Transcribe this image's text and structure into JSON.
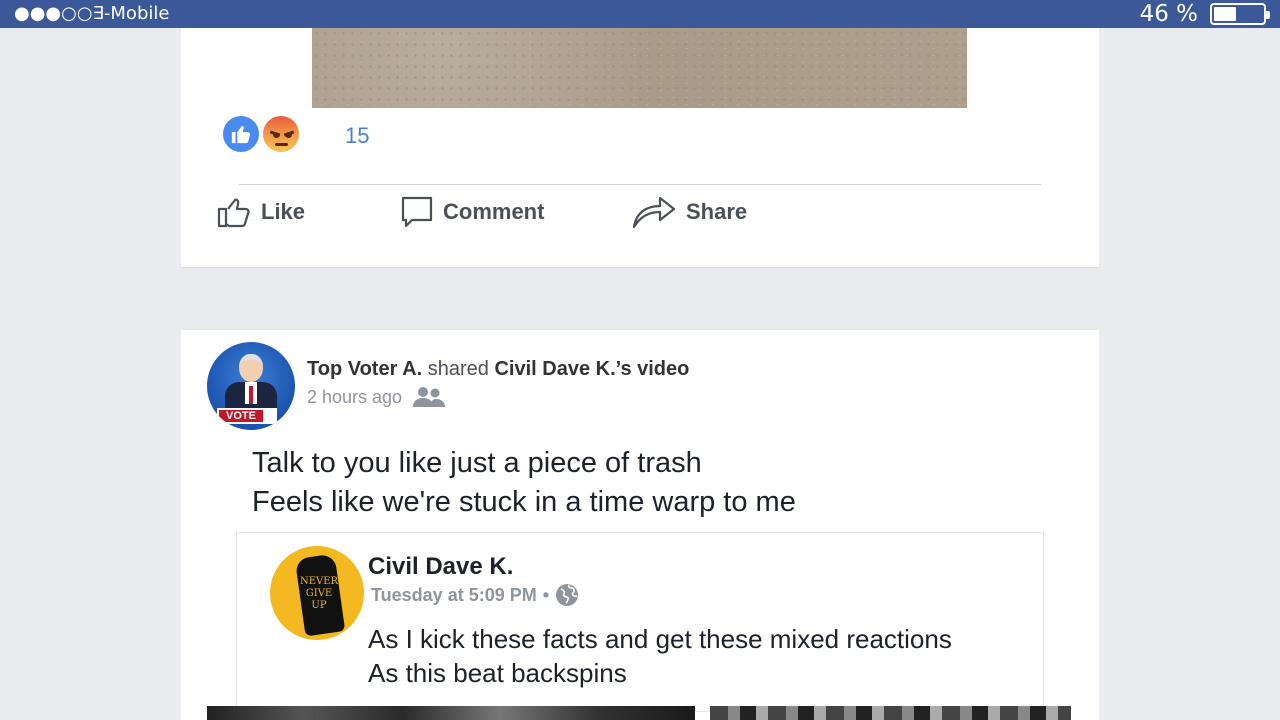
{
  "status_bar": {
    "carrier": "●●●○○∃-Mobile",
    "battery_percent": "46 %",
    "battery_level": 0.46
  },
  "post1": {
    "reaction_count": "15",
    "reactions": [
      "like-icon",
      "angry-icon"
    ],
    "actions": {
      "like": "Like",
      "comment": "Comment",
      "share": "Share"
    }
  },
  "post2": {
    "author": "Top Voter A.",
    "verb": "shared",
    "shared_from": "Civil Dave K.’s video",
    "time": "2 hours ago",
    "avatar_badge": "VOTE",
    "text_lines": [
      "Talk to you like just a piece of trash",
      "Feels like we're stuck in a time warp to me"
    ],
    "shared_post": {
      "author": "Civil Dave K.",
      "time": "Tuesday at 5:09 PM",
      "separator": "•",
      "avatar_text": [
        "NEVER",
        "GIVE",
        "UP"
      ],
      "text_lines": [
        "As I kick these facts and get these mixed reactions",
        "As this beat backspins"
      ]
    }
  },
  "colors": {
    "brand": "#3b5998",
    "like_blue": "#4a8bef",
    "text_primary": "#1d2129",
    "text_secondary": "#90949c",
    "background": "#e9ebee"
  }
}
